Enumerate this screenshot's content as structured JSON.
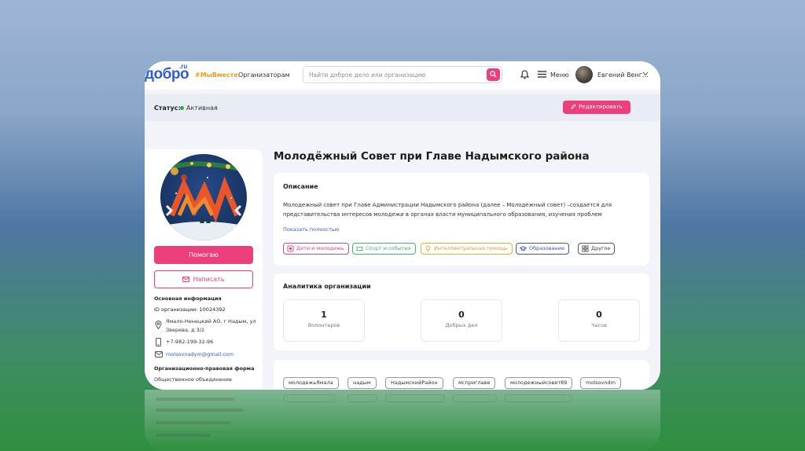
{
  "header": {
    "logo": "добро",
    "logo_suffix": ".ru",
    "nav_tag": "#МыВместе",
    "nav_organizers": "Организаторам",
    "search_placeholder": "Найти доброе дело или организацию",
    "menu_label": "Меню",
    "user_name": "Евгений Венг..."
  },
  "status": {
    "label": "Статус:",
    "value": "Активная",
    "edit_button": "Редактировать"
  },
  "sidebar": {
    "help_button": "Помогаю",
    "write_button": "Написать",
    "info_title": "Основная информация",
    "org_id": "ID организации: 10024392",
    "address": "Ямало-Ненецкий АО, г Надым, ул Зверева, д 3/2",
    "phone": "+7-982-199-32-96",
    "email": "molsovnadym@gmail.com",
    "legal_form_title": "Организационно-правовая форма",
    "legal_form_value": "Общественное объединение"
  },
  "main": {
    "title": "Молодёжный Совет при Главе Надымского района",
    "description": {
      "heading": "Описание",
      "text": "Молодежный совет при Главе Администрации Надымского района (далее – Молодежный совет) –создается для представительства интересов молодежи в органах власти муниципального образования, изучения проблем",
      "show_more": "Показать полностью"
    },
    "categories": [
      {
        "label": "Дети и молодежь",
        "color": "#e0457b",
        "icon": "heart-icon"
      },
      {
        "label": "Спорт и события",
        "color": "#3cba6b",
        "icon": "ticket-icon"
      },
      {
        "label": "Интеллектуальная помощь",
        "color": "#e6a93a",
        "icon": "bulb-icon"
      },
      {
        "label": "Образование",
        "color": "#3f55c4",
        "icon": "graduation-cap-icon"
      },
      {
        "label": "Другое",
        "color": "#555555",
        "icon": "grid-icon"
      }
    ],
    "analytics": {
      "heading": "Аналитика организации",
      "stats": [
        {
          "value": "1",
          "label": "Волонтеров"
        },
        {
          "value": "0",
          "label": "Добрых дел"
        },
        {
          "value": "0",
          "label": "Часов"
        }
      ]
    },
    "hashtags": [
      "молодежьЯмала",
      "надым",
      "НадымскийРайон",
      "мсприглаве",
      "молодежныйсовет89",
      "molsovndm"
    ]
  }
}
